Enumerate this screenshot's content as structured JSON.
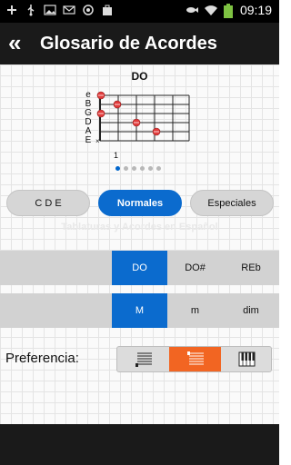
{
  "status_bar": {
    "time": "09:19",
    "icons": [
      "add-icon",
      "usb-icon",
      "image-icon",
      "mail-icon",
      "sync-icon",
      "bag-icon",
      "fish-icon",
      "wifi-icon",
      "battery-icon"
    ]
  },
  "action_bar": {
    "back_label": "«",
    "title": "Glosario de Acordes"
  },
  "chord": {
    "name": "DO",
    "strings": [
      "e",
      "B",
      "G",
      "D",
      "A",
      "E"
    ],
    "start_fret": "1",
    "muted_mark": "×",
    "page_count": 6,
    "active_page": 1
  },
  "watermark": "Tablaturas y Acordes en Español",
  "categories": [
    {
      "label": "C D E",
      "active": false
    },
    {
      "label": "Normales",
      "active": true
    },
    {
      "label": "Especiales",
      "active": false
    }
  ],
  "notes": [
    {
      "label": "DO",
      "active": true
    },
    {
      "label": "DO#",
      "active": false
    },
    {
      "label": "REb",
      "active": false
    }
  ],
  "chord_types": [
    {
      "label": "M",
      "active": true
    },
    {
      "label": "m",
      "active": false
    },
    {
      "label": "dim",
      "active": false
    }
  ],
  "preference": {
    "label": "Preferencia:",
    "options": [
      {
        "icon": "tablature-icon",
        "active": false
      },
      {
        "icon": "chord-diagram-icon",
        "active": true
      },
      {
        "icon": "piano-icon",
        "active": false
      }
    ]
  },
  "colors": {
    "accent_blue": "#0b6bce",
    "accent_orange": "#f26522",
    "finger_dot": "#e23b3b"
  }
}
